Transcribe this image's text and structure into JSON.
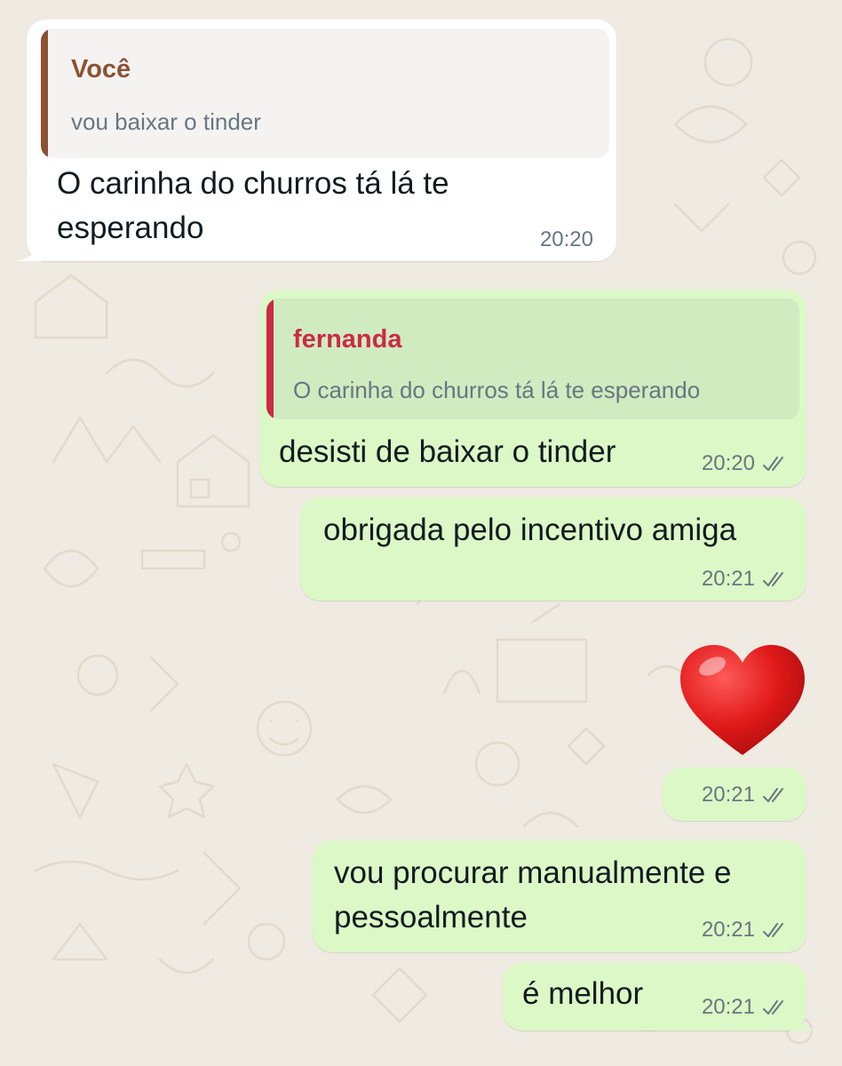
{
  "messages": [
    {
      "direction": "incoming",
      "quote": {
        "author": "Você",
        "text": "vou baixar o tinder",
        "author_color": "#8b5232"
      },
      "lines": [
        "O carinha do churros tá lá te",
        "esperando"
      ],
      "time": "20:20"
    },
    {
      "direction": "outgoing",
      "quote": {
        "author": "fernanda",
        "text": "O carinha do churros tá lá te esperando",
        "author_color": "#cc2a45"
      },
      "lines": [
        "desisti de baixar o tinder"
      ],
      "time": "20:20",
      "status": "read"
    },
    {
      "direction": "outgoing",
      "lines": [
        "obrigada pelo incentivo amiga"
      ],
      "time": "20:21",
      "status": "read"
    },
    {
      "direction": "outgoing",
      "emoji": "heart-emoji",
      "time": "20:21",
      "status": "read"
    },
    {
      "direction": "outgoing",
      "lines": [
        "vou procurar manualmente e",
        "pessoalmente"
      ],
      "time": "20:21",
      "status": "read"
    },
    {
      "direction": "outgoing",
      "lines": [
        "é melhor"
      ],
      "time": "20:21",
      "status": "read"
    }
  ],
  "colors": {
    "wallpaper": "#efeae2",
    "incoming_bubble": "#ffffff",
    "outgoing_bubble": "#dcf8c6",
    "incoming_quote_bg": "#f5f3f2",
    "outgoing_quote_bg": "#d0ebc0",
    "timestamp": "#667781",
    "read_ticks": "#667781"
  }
}
